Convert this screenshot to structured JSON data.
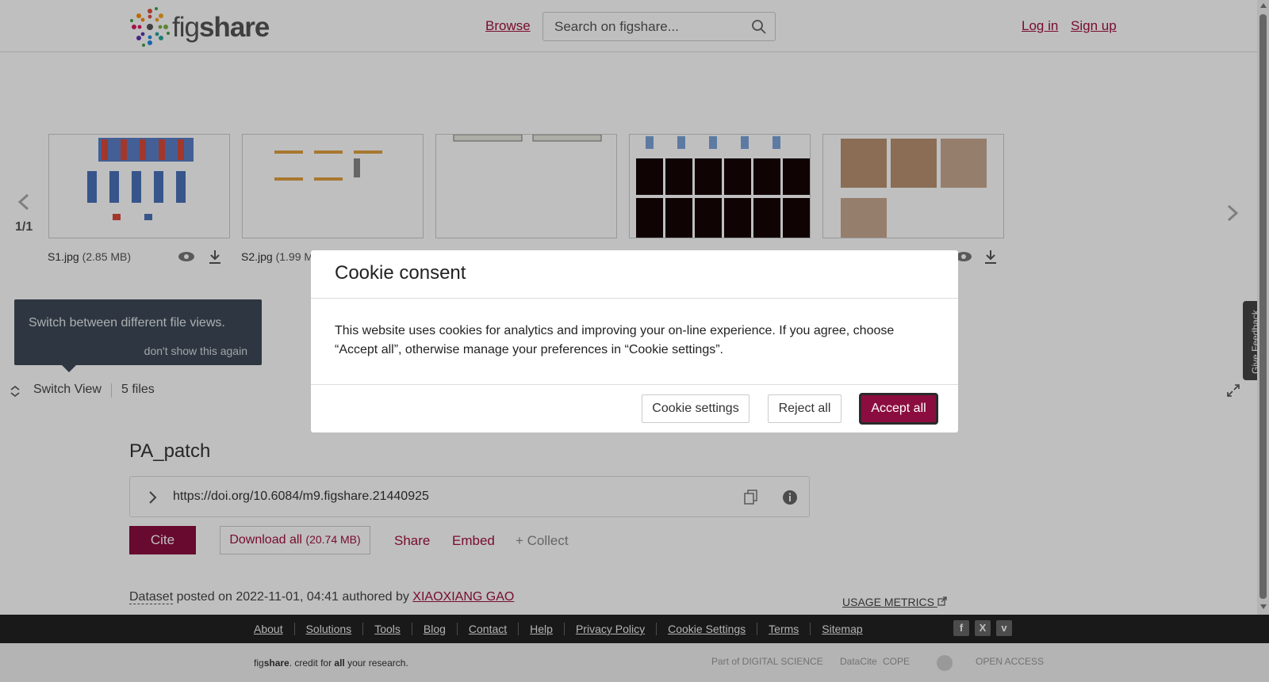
{
  "header": {
    "logo_prefix": "fig",
    "logo_bold": "share",
    "browse": "Browse",
    "search_placeholder": "Search on figshare...",
    "login": "Log in",
    "signup": "Sign up"
  },
  "viewer": {
    "page_count": "1/1",
    "files": [
      {
        "name": "S1.jpg",
        "size": "(2.85 MB)"
      },
      {
        "name": "S2.jpg",
        "size": "(1.99 M"
      }
    ],
    "tooltip_message": "Switch between different file views.",
    "tooltip_dismiss": "don't show this again",
    "switch_view": "Switch View",
    "files_count": "5 files"
  },
  "feedback": "Give Feedback",
  "item": {
    "title": "PA_patch",
    "doi": "https://doi.org/10.6084/m9.figshare.21440925",
    "cite": "Cite",
    "download_label": "Download all",
    "download_size": "(20.74 MB)",
    "share": "Share",
    "embed": "Embed",
    "collect": "+ Collect",
    "type": "Dataset",
    "posted_text": " posted on 2022-11-01, 04:41 authored by ",
    "author": "XIAOXIANG GAO",
    "usage_metrics": "USAGE METRICS"
  },
  "footer": {
    "links": [
      "About",
      "Solutions",
      "Tools",
      "Blog",
      "Contact",
      "Help",
      "Privacy Policy",
      "Cookie Settings",
      "Terms",
      "Sitemap"
    ],
    "social": [
      "f",
      "X",
      "v"
    ],
    "tagline_1": "fig",
    "tagline_2": "share",
    "tagline_3": ". credit for ",
    "tagline_4": "all",
    "tagline_5": " your research.",
    "partners": [
      "Part of DIGITAL SCIENCE",
      "DataCite",
      "COPE",
      "",
      "OPEN ACCESS"
    ]
  },
  "cookie_modal": {
    "title": "Cookie consent",
    "body": "This website uses cookies for analytics and improving your on-line experience. If you agree, choose “Accept all”, otherwise manage your preferences in “Cookie settings”.",
    "settings": "Cookie settings",
    "reject": "Reject all",
    "accept": "Accept all"
  },
  "colors": {
    "brand": "#8b0d3f",
    "link": "#a0123f",
    "tooltip_bg": "#3e4a57",
    "footer_bg": "#222222"
  }
}
